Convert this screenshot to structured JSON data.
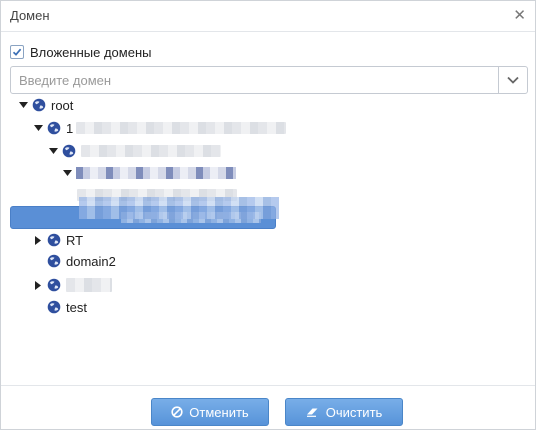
{
  "dialog": {
    "title": "Домен",
    "close_icon": "close-icon"
  },
  "nested_domains": {
    "label": "Вложенные домены",
    "checked": true
  },
  "domain_input": {
    "placeholder": "Введите домен",
    "value": ""
  },
  "tree": {
    "root_label": "root",
    "child1_prefix": "1",
    "nodes": [
      {
        "label": "RT",
        "expandable": true
      },
      {
        "label": "domain2",
        "expandable": false
      },
      {
        "label": "",
        "expandable": true
      },
      {
        "label": "test",
        "expandable": false
      }
    ]
  },
  "buttons": {
    "cancel_label": "Отменить",
    "clear_label": "Очистить"
  },
  "colors": {
    "accent": "#5793d9",
    "selection": "#5a8fd6",
    "globe": "#2f4f9e"
  }
}
